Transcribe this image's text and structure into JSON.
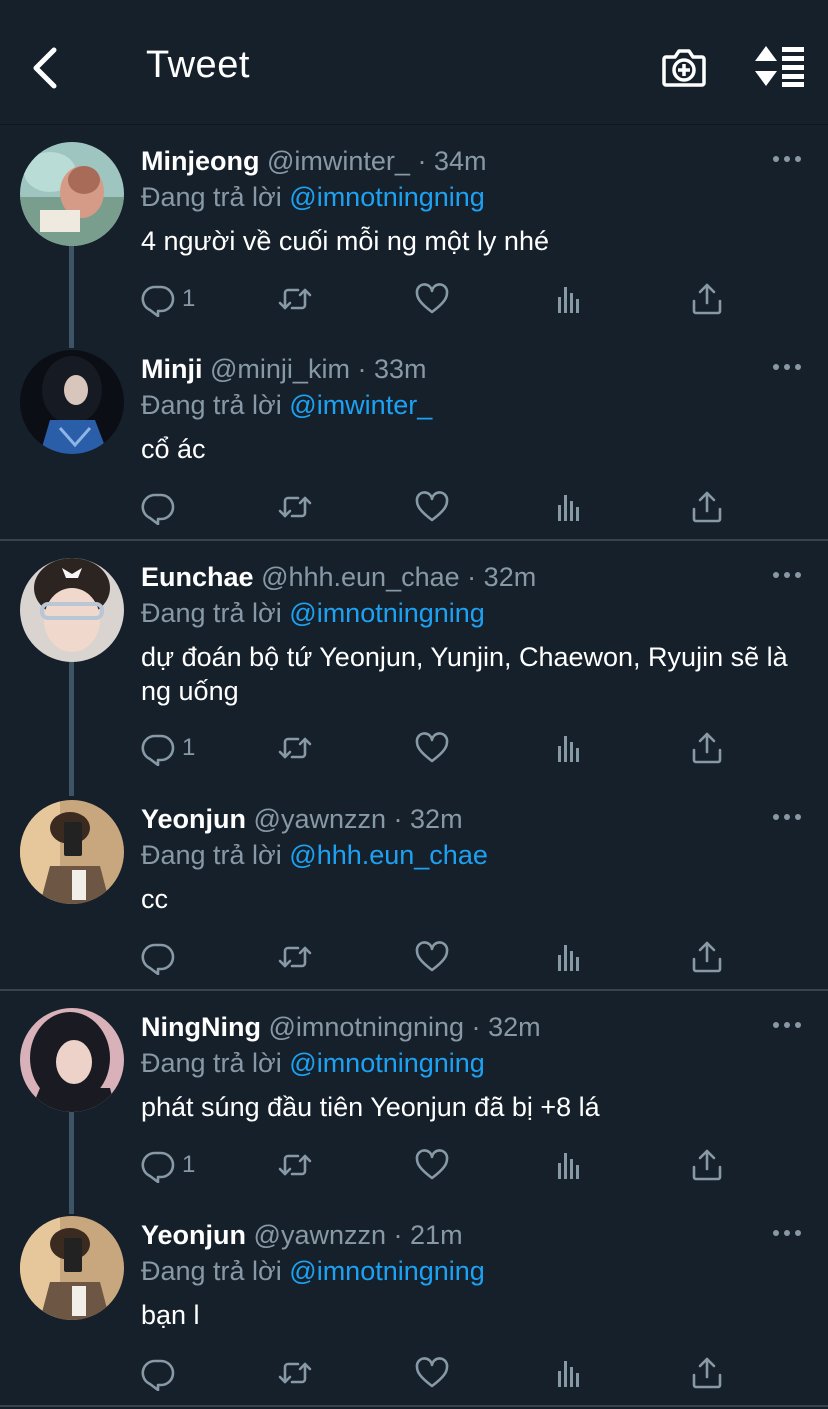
{
  "header": {
    "title": "Tweet"
  },
  "icons": {
    "back": "chevron-left-icon",
    "camera": "camera-plus-icon",
    "sort": "sort-icon",
    "reply": "reply-icon",
    "retweet": "retweet-icon",
    "like": "heart-icon",
    "analytics": "analytics-icon",
    "share": "share-icon",
    "more": "more-icon"
  },
  "colors": {
    "background": "#15202b",
    "mention": "#1da1f2",
    "secondary_text": "#8899a6",
    "divider": "#38444d"
  },
  "replying_label": "Đang trả lời",
  "tweets": [
    {
      "name": "Minjeong",
      "handle": "@imwinter_",
      "dot": "·",
      "time": "34m",
      "reply_to": "@imnotningning",
      "text": "4 người về cuối mỗi ng một ly nhé",
      "reply_count": "1"
    },
    {
      "name": "Minji",
      "handle": "@minji_kim",
      "dot": "·",
      "time": "33m",
      "reply_to": "@imwinter_",
      "text": "cổ ác",
      "reply_count": ""
    },
    {
      "name": "Eunchae",
      "handle": "@hhh.eun_chae",
      "dot": "·",
      "time": "32m",
      "reply_to": "@imnotningning",
      "text": "dự đoán bộ tứ Yeonjun, Yunjin, Chaewon, Ryujin sẽ là ng uống",
      "reply_count": "1"
    },
    {
      "name": "Yeonjun",
      "handle": "@yawnzzn",
      "dot": "·",
      "time": "32m",
      "reply_to": "@hhh.eun_chae",
      "text": "cc",
      "reply_count": ""
    },
    {
      "name": "NingNing",
      "handle": "@imnotningning",
      "dot": "·",
      "time": "32m",
      "reply_to": "@imnotningning",
      "text": "phát súng đầu tiên Yeonjun đã bị +8 lá",
      "reply_count": "1"
    },
    {
      "name": "Yeonjun",
      "handle": "@yawnzzn",
      "dot": "·",
      "time": "21m",
      "reply_to": "@imnotningning",
      "text": "bạn l",
      "reply_count": ""
    }
  ]
}
